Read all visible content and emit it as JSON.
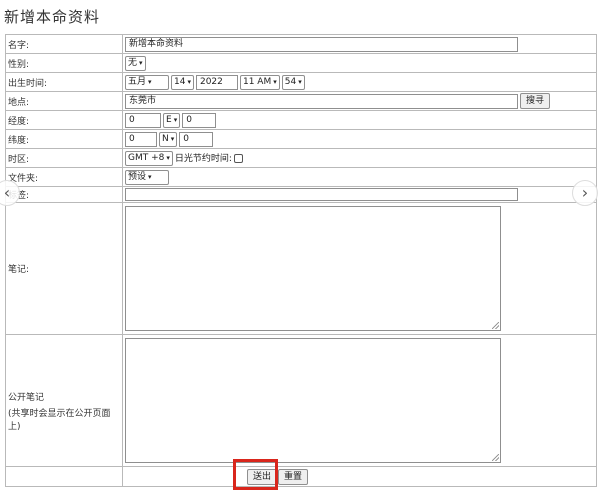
{
  "page": {
    "title": "新增本命资料"
  },
  "form": {
    "name": {
      "label": "名字:",
      "value": "新增本命资料"
    },
    "gender": {
      "label": "性别:",
      "value": "无"
    },
    "birth_time": {
      "label": "出生时间:",
      "month": "五月",
      "day": "14",
      "year": "2022",
      "hour": "11 AM",
      "minute": "54"
    },
    "place": {
      "label": "地点:",
      "value": "东莞市",
      "search_button": "搜寻"
    },
    "longitude": {
      "label": "经度:",
      "deg": "0",
      "dir": "E",
      "min": "0"
    },
    "latitude": {
      "label": "纬度:",
      "deg": "0",
      "dir": "N",
      "min": "0"
    },
    "timezone": {
      "label": "时区:",
      "value": "GMT +8",
      "dst_label": "日光节约时间:"
    },
    "folder": {
      "label": "文件夹:",
      "value": "预设"
    },
    "tags": {
      "label": "标签:",
      "value": ""
    },
    "notes": {
      "label": "笔记:",
      "value": ""
    },
    "public_notes": {
      "label": "公开笔记",
      "hint": "(共享时会显示在公开页面上)",
      "value": ""
    },
    "submit_button": "送出",
    "reset_button": "重置"
  },
  "icons": {
    "prev": "chevron-left-icon",
    "next": "chevron-right-icon"
  },
  "colors": {
    "highlight": "#d9261c"
  }
}
